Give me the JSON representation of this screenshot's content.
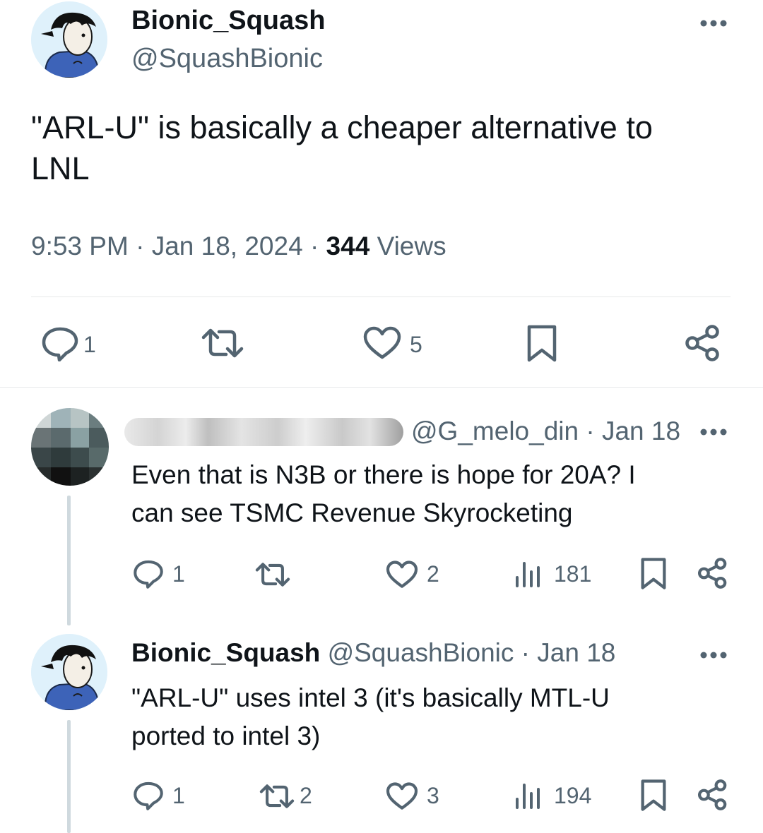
{
  "main_tweet": {
    "display_name": "Bionic_Squash",
    "handle": "@SquashBionic",
    "text_line1": "\"ARL-U\" is basically a cheaper alternative to",
    "text_line2": "LNL",
    "time": "9:53 PM",
    "date": "Jan 18, 2024",
    "sep": "·",
    "views_count": "344",
    "views_label": "Views",
    "reply_count": "1",
    "like_count": "5"
  },
  "reply1": {
    "handle": "@G_melo_din",
    "sep": "·",
    "date": "Jan 18",
    "text_line1": "Even that is N3B or there is hope for 20A? I",
    "text_line2": "can see TSMC Revenue Skyrocketing",
    "reply_count": "1",
    "like_count": "2",
    "views_count": "181"
  },
  "reply2": {
    "display_name": "Bionic_Squash",
    "handle": "@SquashBionic",
    "sep": "·",
    "date": "Jan 18",
    "text_line1": "\"ARL-U\" uses intel 3 (it's basically MTL-U",
    "text_line2": "ported to intel 3)",
    "reply_count": "1",
    "retweet_count": "2",
    "like_count": "3",
    "views_count": "194"
  },
  "colors": {
    "text": "#0f1419",
    "muted": "#536471",
    "divider": "#e7e9ea",
    "thread_line": "#cfd9de",
    "avatar_bg": "#dff1fb",
    "hoodie": "#3d63b8"
  },
  "icons": [
    "more-icon",
    "reply-icon",
    "retweet-icon",
    "like-icon",
    "bookmark-icon",
    "share-icon",
    "views-icon"
  ]
}
